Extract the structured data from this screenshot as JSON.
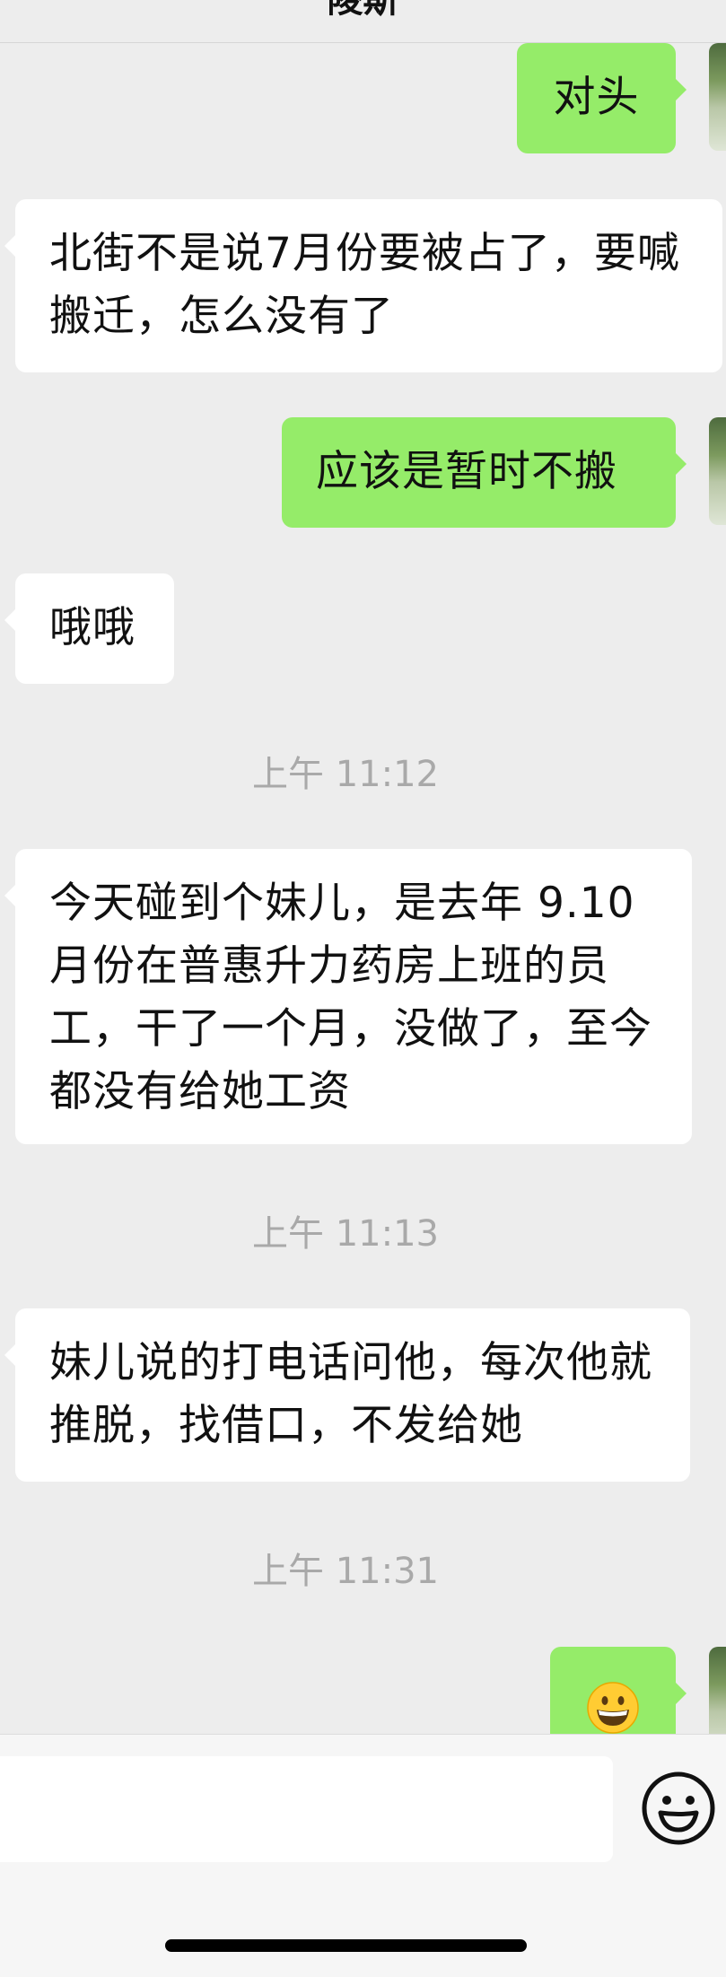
{
  "header": {
    "title": "陵斯"
  },
  "messages": [
    {
      "side": "out",
      "text": "对头"
    },
    {
      "side": "in",
      "text": "北街不是说7月份要被占了，要喊搬迁，怎么没有了"
    },
    {
      "side": "out",
      "text": "应该是暂时不搬"
    },
    {
      "side": "in",
      "text": "哦哦"
    },
    {
      "type": "time",
      "text": "上午 11:12"
    },
    {
      "side": "in",
      "text": "今天碰到个妹儿，是去年 9.10月份在普惠升力药房上班的员工，干了一个月，没做了，至今都没有给她工资"
    },
    {
      "type": "time",
      "text": "上午 11:13"
    },
    {
      "side": "in",
      "text": "妹儿说的打电话问他，每次他就推脱，找借口，不发给她"
    },
    {
      "type": "time",
      "text": "上午 11:31"
    },
    {
      "side": "out",
      "emoji": "grinning-face"
    }
  ],
  "input": {
    "placeholder": ""
  },
  "colors": {
    "background": "#ededed",
    "outgoing_bubble": "#95ec69",
    "incoming_bubble": "#ffffff",
    "timestamp_text": "#a9a9a9"
  }
}
